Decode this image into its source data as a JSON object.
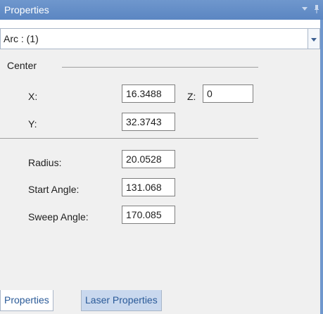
{
  "panel": {
    "title": "Properties"
  },
  "selector": {
    "value": "Arc : (1)"
  },
  "center": {
    "group_label": "Center",
    "x_label": "X:",
    "x_value": "16.3488",
    "z_label": "Z:",
    "z_value": "0",
    "y_label": "Y:",
    "y_value": "32.3743"
  },
  "arc": {
    "radius_label": "Radius:",
    "radius_value": "20.0528",
    "start_angle_label": "Start Angle:",
    "start_angle_value": "131.068",
    "sweep_angle_label": "Sweep Angle:",
    "sweep_angle_value": "170.085"
  },
  "tabs": [
    {
      "label": "Properties",
      "active": true
    },
    {
      "label": "Laser Properties",
      "active": false
    }
  ],
  "icons": {
    "titlebar": [
      "dropdown-arrow-icon",
      "pin-icon"
    ],
    "selector": "chevron-down-icon"
  }
}
